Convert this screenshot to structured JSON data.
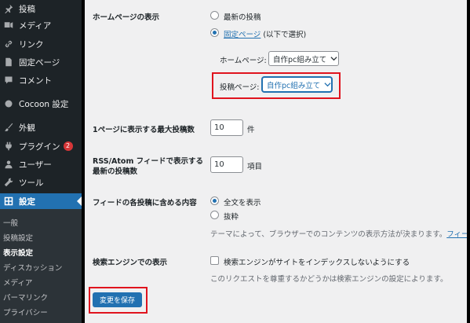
{
  "sidebar": {
    "items": [
      {
        "label": "投稿",
        "icon": "pin-icon"
      },
      {
        "label": "メディア",
        "icon": "media-icon"
      },
      {
        "label": "リンク",
        "icon": "link-icon"
      },
      {
        "label": "固定ページ",
        "icon": "page-icon"
      },
      {
        "label": "コメント",
        "icon": "comment-icon"
      },
      {
        "label": "Cocoon 設定",
        "icon": "circle-icon"
      },
      {
        "label": "外観",
        "icon": "brush-icon"
      },
      {
        "label": "プラグイン",
        "icon": "plugin-icon",
        "badge": "2"
      },
      {
        "label": "ユーザー",
        "icon": "user-icon"
      },
      {
        "label": "ツール",
        "icon": "wrench-icon"
      },
      {
        "label": "設定",
        "icon": "settings-icon"
      }
    ],
    "submenu": [
      "一般",
      "投稿設定",
      "表示設定",
      "ディスカッション",
      "メディア",
      "パーマリンク",
      "プライバシー"
    ]
  },
  "homepage": {
    "label": "ホームページの表示",
    "option_latest": "最新の投稿",
    "option_static_link": "固定ページ",
    "option_static_suffix": "(以下で選択)",
    "homepage_label": "ホームページ:",
    "homepage_value": "自作pc組み立て",
    "posts_page_label": "投稿ページ:",
    "posts_page_value": "自作pc組み立て"
  },
  "posts_per_page": {
    "label": "1ページに表示する最大投稿数",
    "value": "10",
    "unit": "件"
  },
  "feed_count": {
    "label_line1": "RSS/Atom フィードで表示する",
    "label_line2": "最新の投稿数",
    "value": "10",
    "unit": "項目"
  },
  "feed_content": {
    "label": "フィードの各投稿に含める内容",
    "option_full": "全文を表示",
    "option_excerpt": "抜粋",
    "note_prefix": "テーマによって、ブラウザーでのコンテンツの表示方法が決まります。",
    "note_link": "フィー"
  },
  "search_engine": {
    "label": "検索エンジンでの表示",
    "checkbox_label": "検索エンジンがサイトをインデックスしないようにする",
    "note": "このリクエストを尊重するかどうかは検索エンジンの設定によります。"
  },
  "save_label": "変更を保存",
  "colors": {
    "accent": "#2271b1",
    "sidebar": "#1d2327",
    "highlight_box": "#e0141e",
    "badge": "#d63638"
  }
}
